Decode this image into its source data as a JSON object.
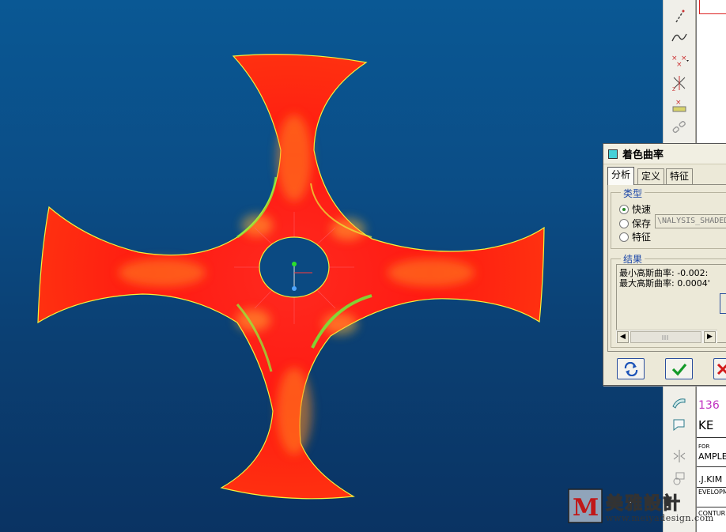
{
  "dialog": {
    "title": "着色曲率",
    "tabs": [
      "分析",
      "定义",
      "特征"
    ],
    "active_tab": "分析",
    "type_group": {
      "label": "类型",
      "options": [
        "快速",
        "保存",
        "特征"
      ],
      "selected": "快速",
      "name_value": "\\NALYSIS_SHADED"
    },
    "results_group": {
      "label": "结果",
      "lines": [
        "最小高斯曲率: -0.002:",
        "最大高斯曲率: 0.0004'"
      ]
    },
    "buttons": {
      "repaint": "repaint",
      "ok": "ok",
      "cancel": "cancel"
    }
  },
  "drawing_panel": {
    "lines": [
      "136",
      "KE",
      "FOR",
      "AMPLE",
      ".J.KIM",
      "EVELOPM",
      "CONTUR"
    ]
  },
  "watermark": {
    "logo": "M",
    "name": "美雅設計",
    "url": "www.meiyadesign.com"
  },
  "colors": {
    "surface": "#ff1a1a",
    "surface_edge": "#f5f02a",
    "background_top": "#0a5894",
    "background_bottom": "#0a3363",
    "accent_blue": "#2b4f9e"
  },
  "icons": [
    "line-icon",
    "spline-icon",
    "point-icon",
    "coordinate-system-icon",
    "datum-analysis-icon",
    "chain-icon",
    "surface-icon",
    "flag-icon",
    "mirror-icon",
    "transform-icon"
  ]
}
